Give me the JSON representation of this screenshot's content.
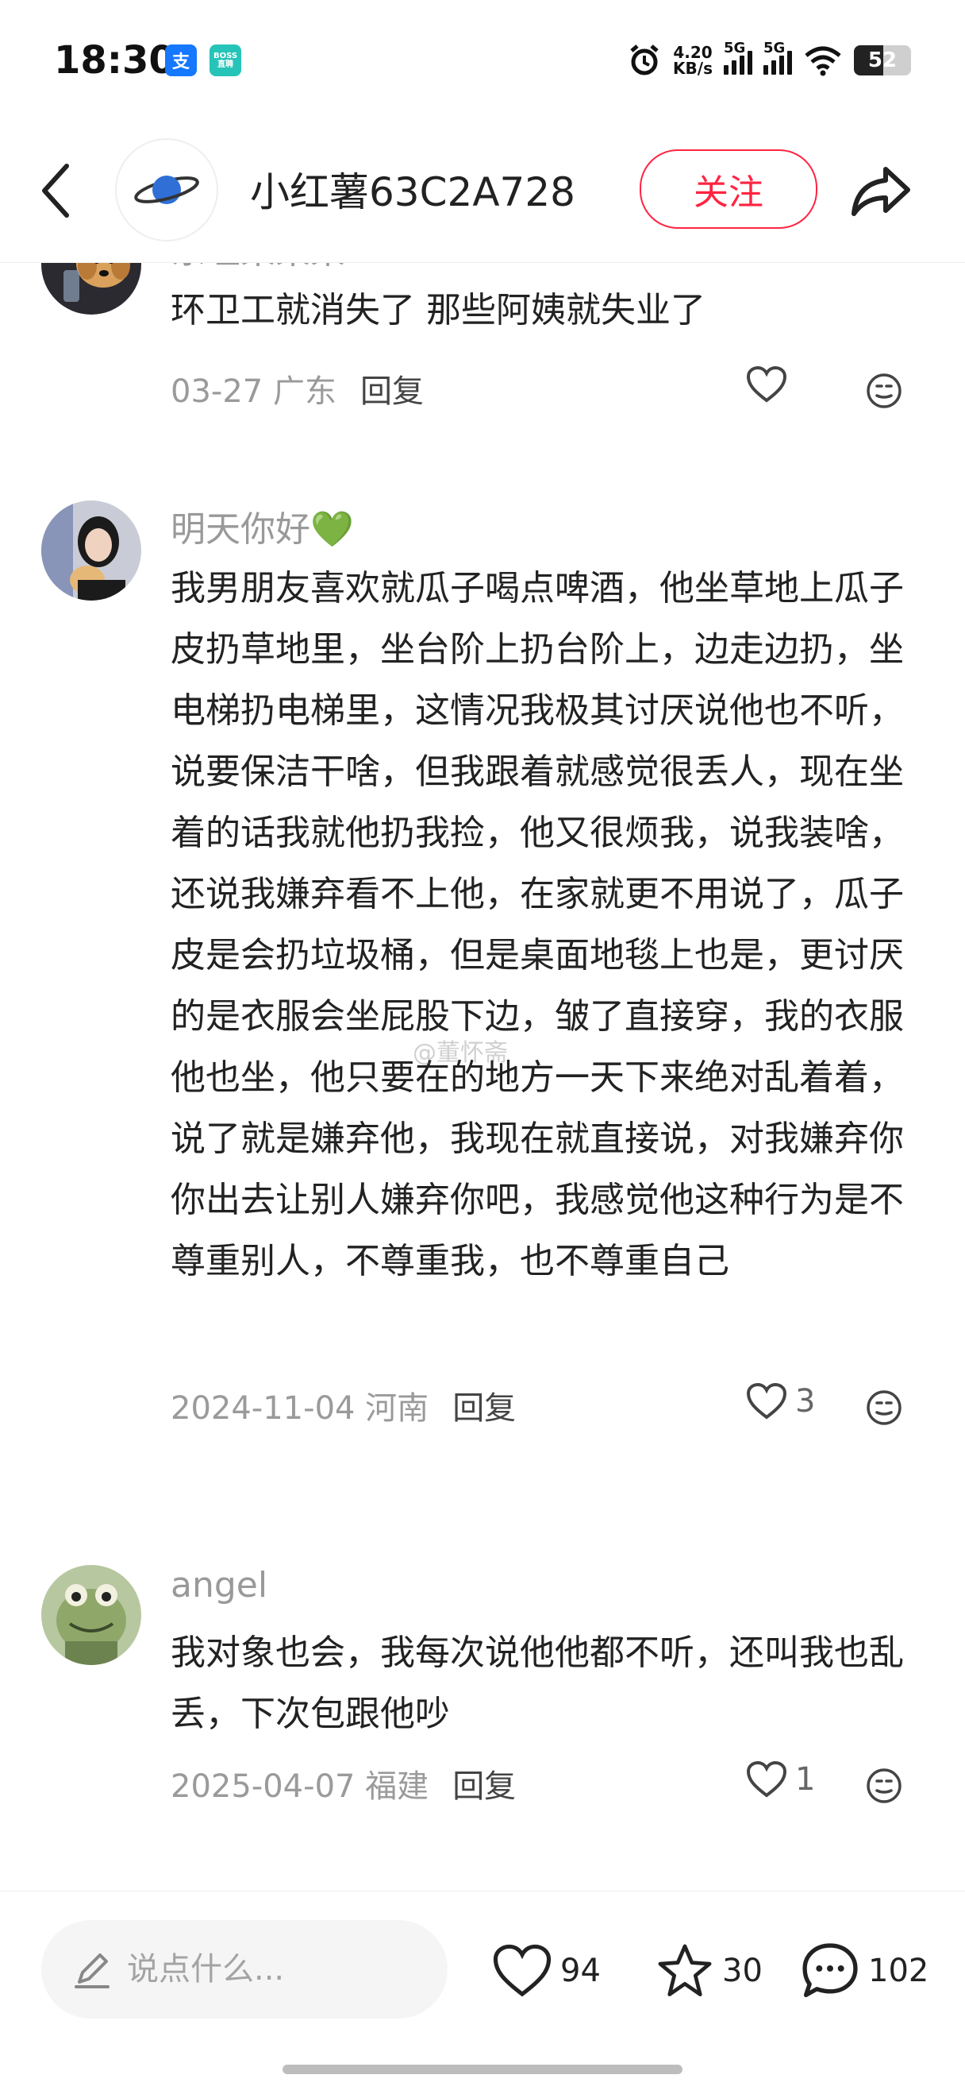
{
  "status_bar": {
    "time": "18:30",
    "app1": "支",
    "app2": "BOSS 直聘",
    "net_speed_value": "4.20",
    "net_speed_unit": "KB/s",
    "sig1": "5G",
    "sig2": "5G",
    "battery": "52"
  },
  "header": {
    "author_name": "小红薯63C2A728",
    "follow_label": "关注"
  },
  "comments": [
    {
      "name": "东哇果果果",
      "text": "环卫工就消失了 那些阿姨就失业了",
      "meta": "03-27 广东",
      "reply": "回复",
      "likes": ""
    },
    {
      "name": "明天你好💚",
      "text": "我男朋友喜欢就瓜子喝点啤酒，他坐草地上瓜子皮扔草地里，坐台阶上扔台阶上，边走边扔，坐电梯扔电梯里，这情况我极其讨厌说他也不听，说要保洁干啥，但我跟着就感觉很丢人，现在坐着的话我就他扔我捡，他又很烦我，说我装啥，还说我嫌弃看不上他，在家就更不用说了，瓜子皮是会扔垃圾桶，但是桌面地毯上也是，更讨厌的是衣服会坐屁股下边，皱了直接穿，我的衣服他也坐，他只要在的地方一天下来绝对乱着着，说了就是嫌弃他，我现在就直接说，对我嫌弃你你出去让别人嫌弃你吧，我感觉他这种行为是不尊重别人，不尊重我，也不尊重自己",
      "meta": "2024-11-04 河南",
      "reply": "回复",
      "likes": "3"
    },
    {
      "name": "angel",
      "text": "我对象也会，我每次说他他都不听，还叫我也乱丢，下次包跟他吵",
      "meta": "2025-04-07 福建",
      "reply": "回复",
      "likes": "1"
    }
  ],
  "watermark": "@董怀斋",
  "bottom_bar": {
    "input_placeholder": "说点什么...",
    "likes": "94",
    "stars": "30",
    "comments": "102"
  },
  "colors": {
    "accent": "#ff2442",
    "muted": "#999999"
  }
}
